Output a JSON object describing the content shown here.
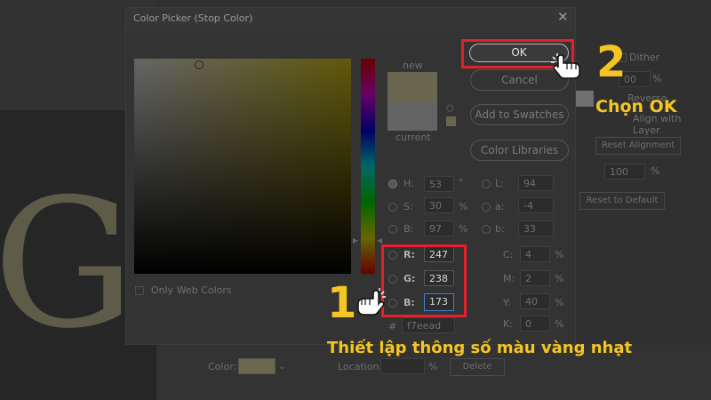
{
  "dialog": {
    "title": "Color Picker (Stop Color)",
    "only_web_colors": "Only Web Colors",
    "new_label": "new",
    "current_label": "current",
    "ok": "OK",
    "cancel": "Cancel",
    "add_to_swatches": "Add to Swatches",
    "color_libraries": "Color Libraries",
    "hsb": [
      {
        "key": "H:",
        "value": "53",
        "unit": "°"
      },
      {
        "key": "S:",
        "value": "30",
        "unit": "%"
      },
      {
        "key": "B:",
        "value": "97",
        "unit": "%"
      }
    ],
    "rgb": [
      {
        "key": "R:",
        "value": "247"
      },
      {
        "key": "G:",
        "value": "238"
      },
      {
        "key": "B:",
        "value": "173"
      }
    ],
    "lab": [
      {
        "key": "L:",
        "value": "94"
      },
      {
        "key": "a:",
        "value": "-4"
      },
      {
        "key": "b:",
        "value": "33"
      }
    ],
    "cmyk": [
      {
        "key": "C:",
        "value": "4",
        "unit": "%"
      },
      {
        "key": "M:",
        "value": "2",
        "unit": "%"
      },
      {
        "key": "Y:",
        "value": "40",
        "unit": "%"
      },
      {
        "key": "K:",
        "value": "0",
        "unit": "%"
      }
    ],
    "hex_label": "#",
    "hex_value": "f7eead",
    "colors": {
      "new": "#f7eead",
      "current": "#f7eead"
    }
  },
  "background_panel": {
    "dither": "Dither",
    "percent_a": "00",
    "unit_a": "%",
    "reverse": "Reverse",
    "align_with_layer": "Align with Layer",
    "reset_alignment": "Reset Alignment",
    "scale_value": "100",
    "unit_b": "%",
    "reset_to_default": "Reset to Default",
    "color_label": "Color:",
    "location_label": "Location:",
    "location_unit": "%",
    "delete": "Delete"
  },
  "canvas_letter": "G",
  "annotations": {
    "step1_number": "1",
    "step1_text": "Thiết lập thông số màu vàng nhạt",
    "step2_number": "2",
    "step2_text": "Chọn OK"
  }
}
